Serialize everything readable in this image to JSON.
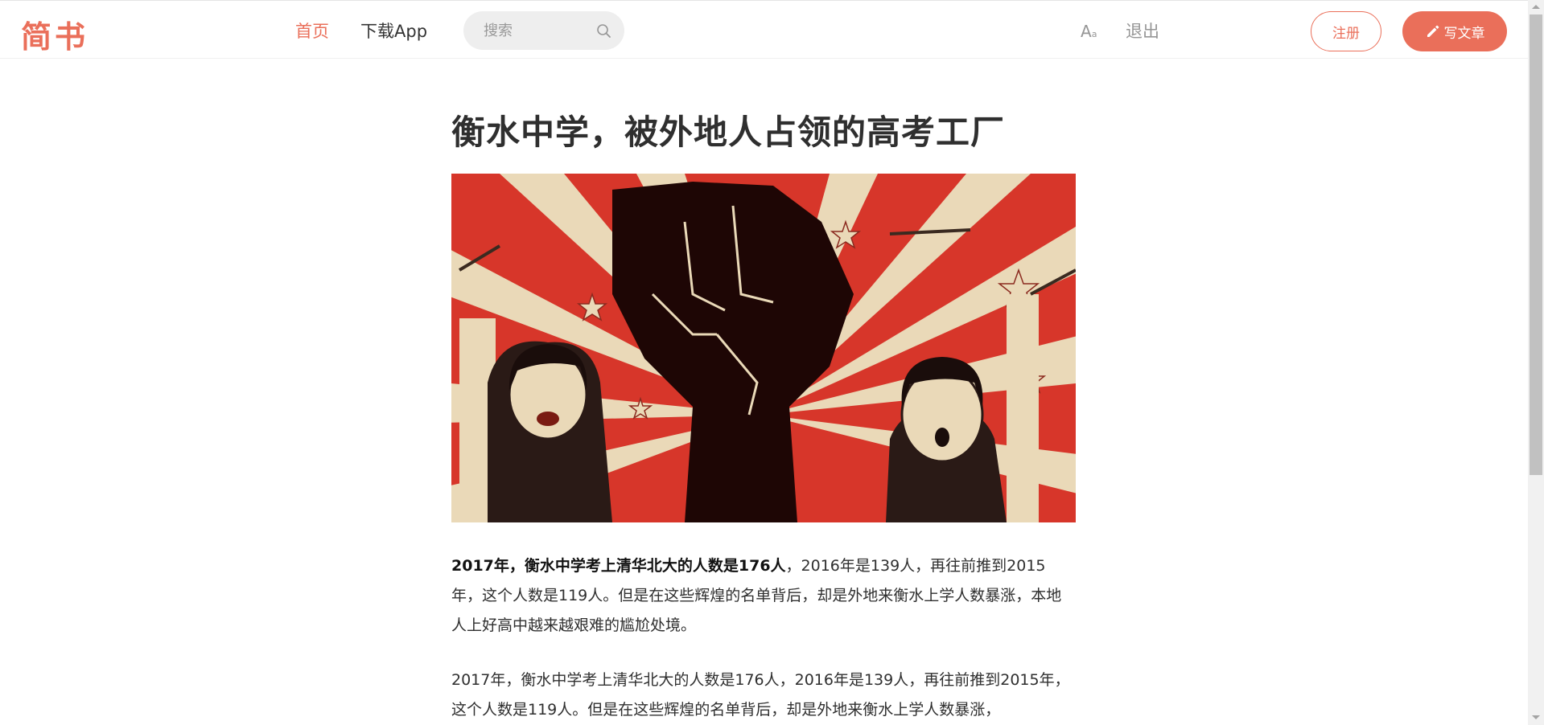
{
  "header": {
    "logo": "简书",
    "nav_home": "首页",
    "nav_app": "下载App",
    "search_placeholder": "搜索",
    "font_toggle_big": "A",
    "font_toggle_small": "a",
    "logout": "退出",
    "register": "注册",
    "write": "写文章"
  },
  "colors": {
    "accent": "#ea6f5a",
    "text": "#2f2f2f",
    "muted": "#969696"
  },
  "article": {
    "title": "衡水中学，被外地人占领的高考工厂",
    "image_alt": "propaganda-style poster with raised fist and students holding pens",
    "paragraphs": [
      {
        "bold": "2017年，衡水中学考上清华北大的人数是176人",
        "text": "，2016年是139人，再往前推到2015年，这个人数是119人。但是在这些辉煌的名单背后，却是外地来衡水上学人数暴涨，本地人上好高中越来越艰难的尴尬处境。"
      },
      {
        "bold": "",
        "text": "2017年，衡水中学考上清华北大的人数是176人，2016年是139人，再往前推到2015年，这个人数是119人。但是在这些辉煌的名单背后，却是外地来衡水上学人数暴涨，"
      }
    ]
  }
}
